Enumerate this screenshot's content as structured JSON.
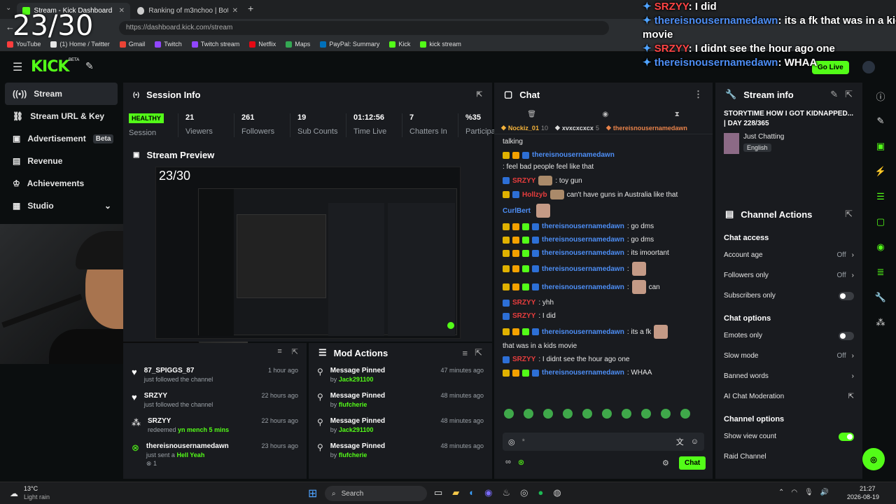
{
  "browser": {
    "tabs": [
      {
        "label": "Stream - Kick Dashboard",
        "active": true
      },
      {
        "label": "Ranking of m3nchoo | BotRix — C",
        "active": false
      }
    ],
    "url": "https://dashboard.kick.com/stream",
    "bookmarks": [
      "YouTube",
      "(1) Home / Twitter",
      "Gmail",
      "Twitch",
      "Twitch stream",
      "Netflix",
      "Maps",
      "PayPal: Summary",
      "Kick",
      "kick stream"
    ]
  },
  "stream_overlay": {
    "counter": "23/30",
    "lines": [
      {
        "user": "SRZYY",
        "text": "I did"
      },
      {
        "user": "thereisnousernamedawn",
        "text": "its a fk",
        "extra": "that was in a kids"
      },
      {
        "user": "",
        "text": "movie"
      },
      {
        "user": "SRZYY",
        "text": "I didnt see the hour ago one"
      },
      {
        "user": "thereisnousernamedawn",
        "text": "WHAA"
      }
    ]
  },
  "topnav": {
    "logo": "KICK",
    "beta": "BETA",
    "go_live": "Go Live"
  },
  "sidebar": {
    "items": [
      {
        "label": "Stream",
        "icon": "broadcast-icon",
        "active": true
      },
      {
        "label": "Stream URL & Key",
        "icon": "link-icon"
      },
      {
        "label": "Advertisement",
        "icon": "ad-icon",
        "badge": "Beta"
      },
      {
        "label": "Revenue",
        "icon": "chart-icon"
      },
      {
        "label": "Achievements",
        "icon": "trophy-icon"
      },
      {
        "label": "Studio",
        "icon": "studio-icon"
      }
    ]
  },
  "session": {
    "title": "Session Info",
    "status": "HEALTHY",
    "status_label": "Session",
    "stats": [
      {
        "value": "21",
        "label": "Viewers"
      },
      {
        "value": "261",
        "label": "Followers"
      },
      {
        "value": "19",
        "label": "Sub Counts"
      },
      {
        "value": "01:12:56",
        "label": "Time Live"
      },
      {
        "value": "7",
        "label": "Chatters In"
      },
      {
        "value": "%35",
        "label": "Participation"
      }
    ]
  },
  "preview": {
    "title": "Stream Preview"
  },
  "activity": {
    "items": [
      {
        "title": "87_SPIGGS_87",
        "sub": "just followed the channel",
        "time": "1 hour ago",
        "icon": "heart-icon"
      },
      {
        "title": "SRZYY",
        "sub": "just followed the channel",
        "time": "22 hours ago",
        "icon": "heart-icon"
      },
      {
        "title": "SRZYY",
        "sub": "redeemed",
        "sub_highlight": "yn mench 5 mins",
        "time": "22 hours ago",
        "icon": "redeem-icon"
      },
      {
        "title": "thereisnousernamedawn",
        "sub": "just sent a",
        "sub_highlight": "Hell Yeah",
        "time": "23 hours ago",
        "icon": "kick-icon",
        "count": "1"
      }
    ]
  },
  "mod_actions": {
    "title": "Mod Actions",
    "items": [
      {
        "title": "Message Pinned",
        "by": "by",
        "user": "Jack291100",
        "time": "47 minutes ago"
      },
      {
        "title": "Message Pinned",
        "by": "by",
        "user": "flufcherie",
        "time": "48 minutes ago"
      },
      {
        "title": "Message Pinned",
        "by": "by",
        "user": "Jack291100",
        "time": "48 minutes ago"
      },
      {
        "title": "Message Pinned",
        "by": "by",
        "user": "flufcherie",
        "time": "48 minutes ago"
      }
    ]
  },
  "chat": {
    "title": "Chat",
    "top_gifters": [
      {
        "name": "Nockiz_01",
        "count": "10"
      },
      {
        "name": "xvxcxcxcx",
        "count": "5"
      },
      {
        "name": "thereisnousernamedawn",
        "count": ""
      }
    ],
    "messages": [
      {
        "user": "",
        "text": "talking"
      },
      {
        "user": "thereisnousernamedawn",
        "text": ": feel bad people feel like that",
        "badges": 2
      },
      {
        "user": "SRZYY",
        "text": ": toy gun",
        "red": true,
        "emote": true
      },
      {
        "user": "Hollzyb",
        "text": "can't have guns in Australia like that",
        "red": true,
        "emote": true,
        "badges": 1
      },
      {
        "user": "CurlBert",
        "text": "",
        "emote": true,
        "plain": true
      },
      {
        "user": "thereisnousernamedawn",
        "text": ": go dms",
        "badges": 3
      },
      {
        "user": "thereisnousernamedawn",
        "text": ": go dms",
        "badges": 3
      },
      {
        "user": "thereisnousernamedawn",
        "text": ": its imoortant",
        "badges": 3
      },
      {
        "user": "thereisnousernamedawn",
        "text": ":",
        "badges": 3,
        "emote": true
      },
      {
        "user": "thereisnousernamedawn",
        "text": ":",
        "badges": 3,
        "emote": true,
        "tail": "can"
      },
      {
        "user": "SRZYY",
        "text": ": yhh",
        "red": true
      },
      {
        "user": "SRZYY",
        "text": ": I did",
        "red": true
      },
      {
        "user": "thereisnousernamedawn",
        "text": ": its a fk",
        "badges": 3,
        "emote": true,
        "tail": "that was in a kids movie"
      },
      {
        "user": "SRZYY",
        "text": ": I didnt see the hour ago one",
        "red": true
      },
      {
        "user": "thereisnousernamedawn",
        "text": ": WHAA",
        "badges": 3
      }
    ],
    "send_label": "Chat",
    "input_placeholder": "*"
  },
  "stream_info": {
    "title": "Stream info",
    "stream_title": "STORYTIME HOW I GOT KIDNAPPED... | DAY 228/365",
    "category": "Just Chatting",
    "language": "English"
  },
  "channel_actions": {
    "title": "Channel Actions",
    "sections": [
      {
        "heading": "Chat access",
        "rows": [
          {
            "label": "Account age",
            "value": "Off",
            "control": "chevron"
          },
          {
            "label": "Followers only",
            "value": "Off",
            "control": "chevron"
          },
          {
            "label": "Subscribers only",
            "value": "",
            "control": "toggle",
            "on": false
          }
        ]
      },
      {
        "heading": "Chat options",
        "rows": [
          {
            "label": "Emotes only",
            "value": "",
            "control": "toggle",
            "on": false
          },
          {
            "label": "Slow mode",
            "value": "Off",
            "control": "chevron"
          },
          {
            "label": "Banned words",
            "value": "",
            "control": "chevron"
          },
          {
            "label": "AI Chat Moderation",
            "value": "",
            "control": "external"
          }
        ]
      },
      {
        "heading": "Channel options",
        "rows": [
          {
            "label": "Show view count",
            "value": "",
            "control": "toggle",
            "on": true
          },
          {
            "label": "Raid Channel",
            "value": "",
            "control": "none"
          }
        ]
      }
    ]
  },
  "taskbar": {
    "weather_temp": "13°C",
    "weather_desc": "Light rain",
    "search": "Search",
    "time": "21:27",
    "date": "2026-08-19"
  },
  "colors": {
    "accent": "#53fc18",
    "panel": "#191b1f",
    "bg": "#0b0e0f",
    "user_blue": "#4d8ef5",
    "user_red": "#e83d3d"
  }
}
